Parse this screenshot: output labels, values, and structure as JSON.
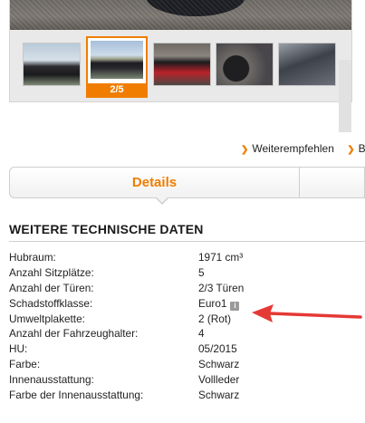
{
  "gallery": {
    "counter": "2/5",
    "thumbnails": [
      "thumbnail-1",
      "thumbnail-2",
      "thumbnail-3",
      "thumbnail-4",
      "thumbnail-5"
    ],
    "active_index": 2
  },
  "links": [
    {
      "label": "Weiterempfehlen",
      "icon": "chevron-right-icon"
    },
    {
      "label": "Be",
      "icon": "chevron-right-icon"
    }
  ],
  "tabs": {
    "active_label": "Details"
  },
  "section": {
    "title": "WEITERE TECHNISCHE DATEN"
  },
  "specs": [
    {
      "label": "Hubraum:",
      "value": "1971 cm³"
    },
    {
      "label": "Anzahl Sitzplätze:",
      "value": "5"
    },
    {
      "label": "Anzahl der Türen:",
      "value": "2/3 Türen"
    },
    {
      "label": "Schadstoffklasse:",
      "value": "Euro1",
      "icon": "info-icon"
    },
    {
      "label": "Umweltplakette:",
      "value": "2 (Rot)"
    },
    {
      "label": "Anzahl der Fahrzeughalter:",
      "value": "4"
    },
    {
      "label": "HU:",
      "value": "05/2015"
    },
    {
      "label": "Farbe:",
      "value": "Schwarz"
    },
    {
      "label": "Innenausstattung:",
      "value": "Vollleder"
    },
    {
      "label": "Farbe der Innenausstattung:",
      "value": "Schwarz"
    }
  ],
  "colors": {
    "accent": "#f07d00",
    "annotation_arrow": "#e53935"
  }
}
